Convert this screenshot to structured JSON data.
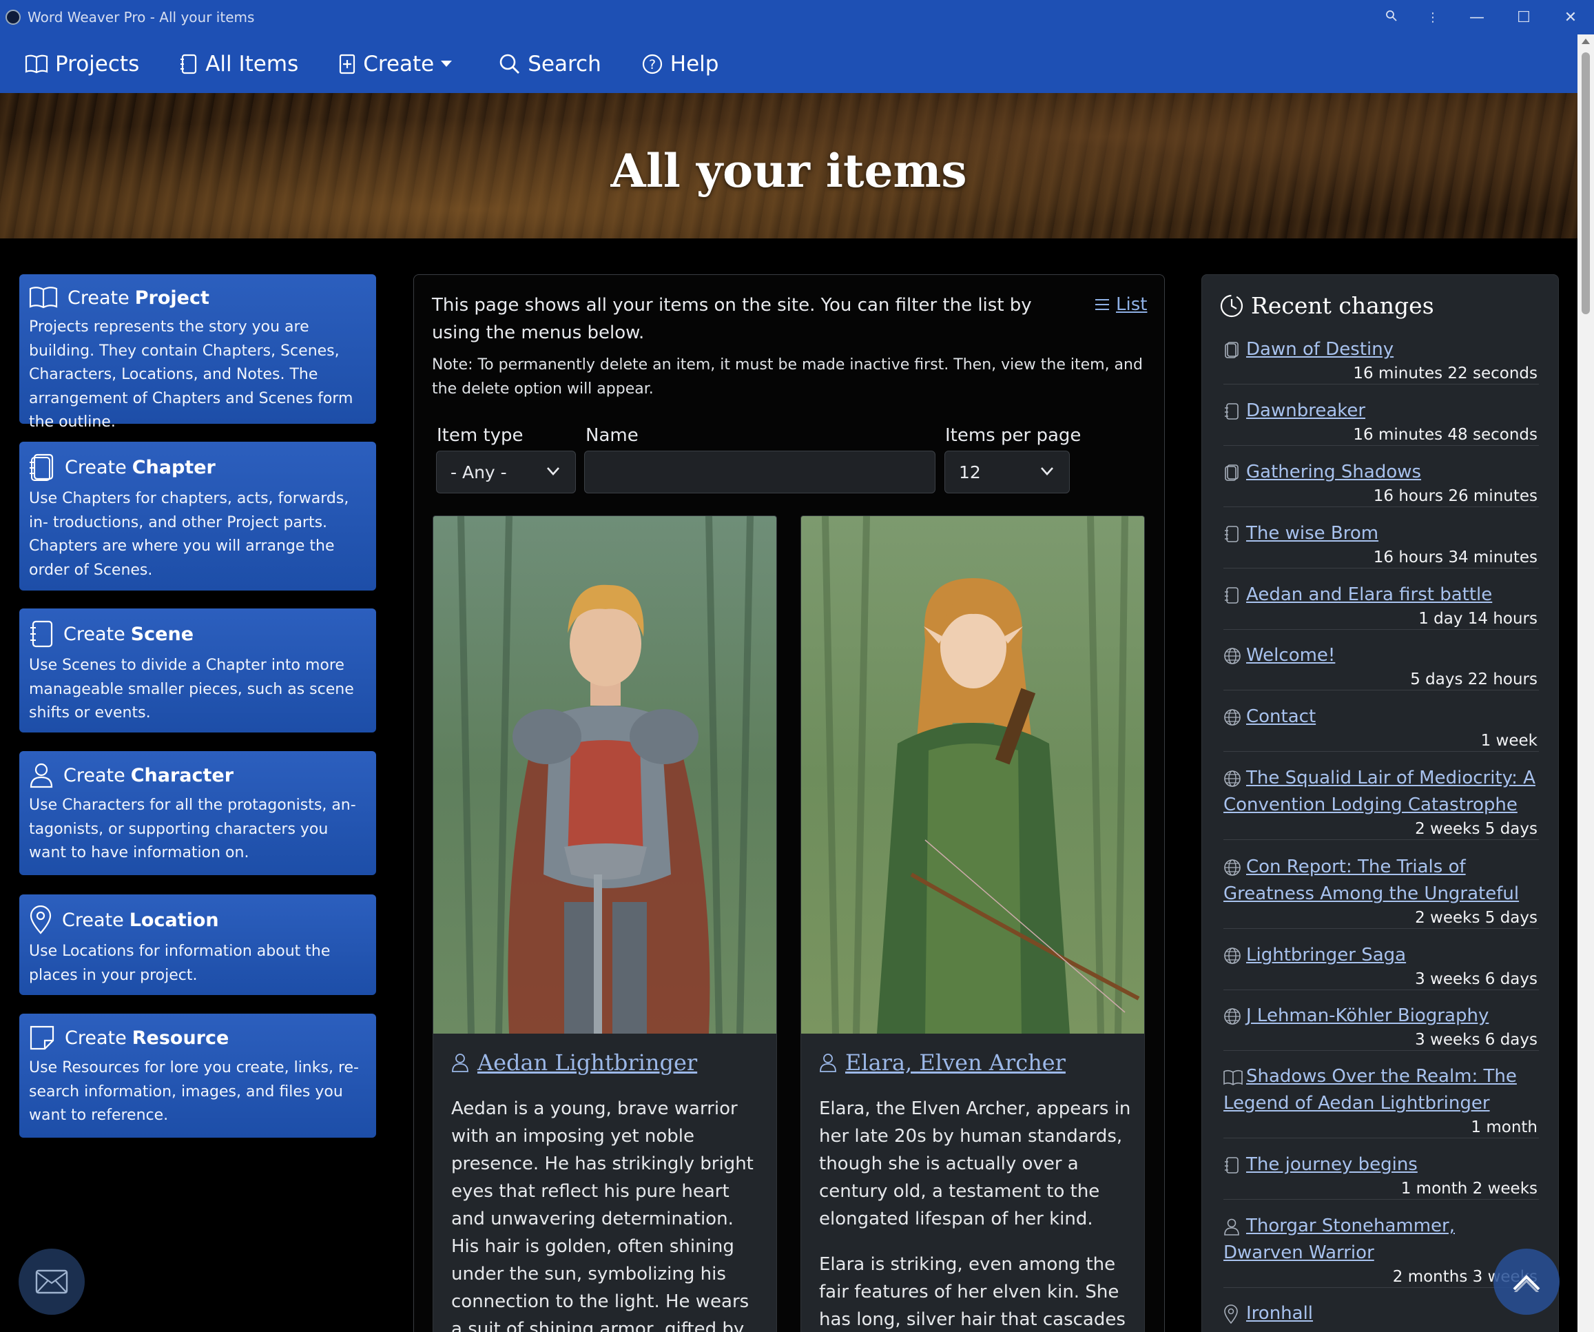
{
  "window": {
    "title": "Word Weaver Pro - All your items"
  },
  "nav": {
    "projects": "Projects",
    "all_items": "All Items",
    "create": "Create",
    "search": "Search",
    "help": "Help"
  },
  "hero": {
    "title": "All your items"
  },
  "create_cards": [
    {
      "prefix": "Create",
      "type": "Project",
      "icon": "book-open-icon",
      "desc": "Projects represents the story you are building. They contain Chapters, Scenes, Characters, Locations, and Notes. The arrangement of Chapters and Scenes form the outline."
    },
    {
      "prefix": "Create",
      "type": "Chapter",
      "icon": "notebook-icon",
      "desc": "Use Chapters for chapters, acts, forwards, in- troductions, and other Project parts. Chapters are where you will arrange the order of Scenes."
    },
    {
      "prefix": "Create",
      "type": "Scene",
      "icon": "journal-icon",
      "desc": "Use Scenes to divide a Chapter into more manageable smaller pieces, such as scene shifts or events."
    },
    {
      "prefix": "Create",
      "type": "Character",
      "icon": "person-icon",
      "desc": "Use Characters for all the protagonists, an- tagonists, or supporting characters you want to have information on."
    },
    {
      "prefix": "Create",
      "type": "Location",
      "icon": "map-pin-icon",
      "desc": "Use Locations for information about the places in your project."
    },
    {
      "prefix": "Create",
      "type": "Resource",
      "icon": "sticky-note-icon",
      "desc": "Use Resources for lore you create, links, re- search information, images, and files you want to reference."
    }
  ],
  "main": {
    "intro": "This page shows all your items on the site. You can filter the list by using the menus below.",
    "list_link": "List",
    "note": "Note: To permanently delete an item, it must be made inactive first. Then, view the item, and the delete option will appear."
  },
  "filters": {
    "item_type_label": "Item type",
    "item_type_value": "- Any -",
    "name_label": "Name",
    "name_value": "",
    "per_page_label": "Items per page",
    "per_page_value": "12"
  },
  "items": [
    {
      "name": "Aedan Lightbringer",
      "paragraphs": [
        "Aedan is a young, brave warrior with an imposing yet noble presence. He has strikingly bright eyes that reflect his pure heart and unwavering determination. His hair is golden, often shining under the sun, symbolizing his connection to the light. He wears a suit of shining armor, gifted by the"
      ]
    },
    {
      "name": "Elara, Elven Archer",
      "paragraphs": [
        "Elara, the Elven Archer, appears in her late 20s by human standards, though she is actually over a century old, a testament to the elongated lifespan of her kind.",
        "Elara is striking, even among the fair features of her elven kin. She has long, silver hair that cascades down"
      ]
    }
  ],
  "recent": {
    "title": "Recent changes",
    "items": [
      {
        "title": "Dawn of Destiny",
        "time": "16 minutes 22 seconds",
        "icon": "chapter-icon"
      },
      {
        "title": "Dawnbreaker",
        "time": "16 minutes 48 seconds",
        "icon": "scene-icon"
      },
      {
        "title": "Gathering Shadows",
        "time": "16 hours 26 minutes",
        "icon": "chapter-icon"
      },
      {
        "title": "The wise Brom",
        "time": "16 hours 34 minutes",
        "icon": "scene-icon"
      },
      {
        "title": "Aedan and Elara first battle",
        "time": "1 day 14 hours",
        "icon": "scene-icon"
      },
      {
        "title": "Welcome!",
        "time": "5 days 22 hours",
        "icon": "globe-icon"
      },
      {
        "title": "Contact",
        "time": "1 week",
        "icon": "globe-icon"
      },
      {
        "title": "The Squalid Lair of Mediocrity: A Convention Lodging Catastrophe",
        "time": "2 weeks 5 days",
        "icon": "globe-icon"
      },
      {
        "title": "Con Report: The Trials of Greatness Among the Ungrateful",
        "time": "2 weeks 5 days",
        "icon": "globe-icon"
      },
      {
        "title": "Lightbringer Saga",
        "time": "3 weeks 6 days",
        "icon": "globe-icon"
      },
      {
        "title": "J Lehman-Köhler Biography",
        "time": "3 weeks 6 days",
        "icon": "globe-icon"
      },
      {
        "title": "Shadows Over the Realm: The Legend of Aedan Lightbringer",
        "time": "1 month",
        "icon": "book-open-icon"
      },
      {
        "title": "The journey begins",
        "time": "1 month 2 weeks",
        "icon": "scene-icon"
      },
      {
        "title": "Thorgar Stonehammer, Dwarven Warrior",
        "time": "2 months 3 weeks",
        "icon": "person-icon"
      },
      {
        "title": "Ironhall",
        "time": "",
        "icon": "map-pin-icon"
      }
    ]
  }
}
